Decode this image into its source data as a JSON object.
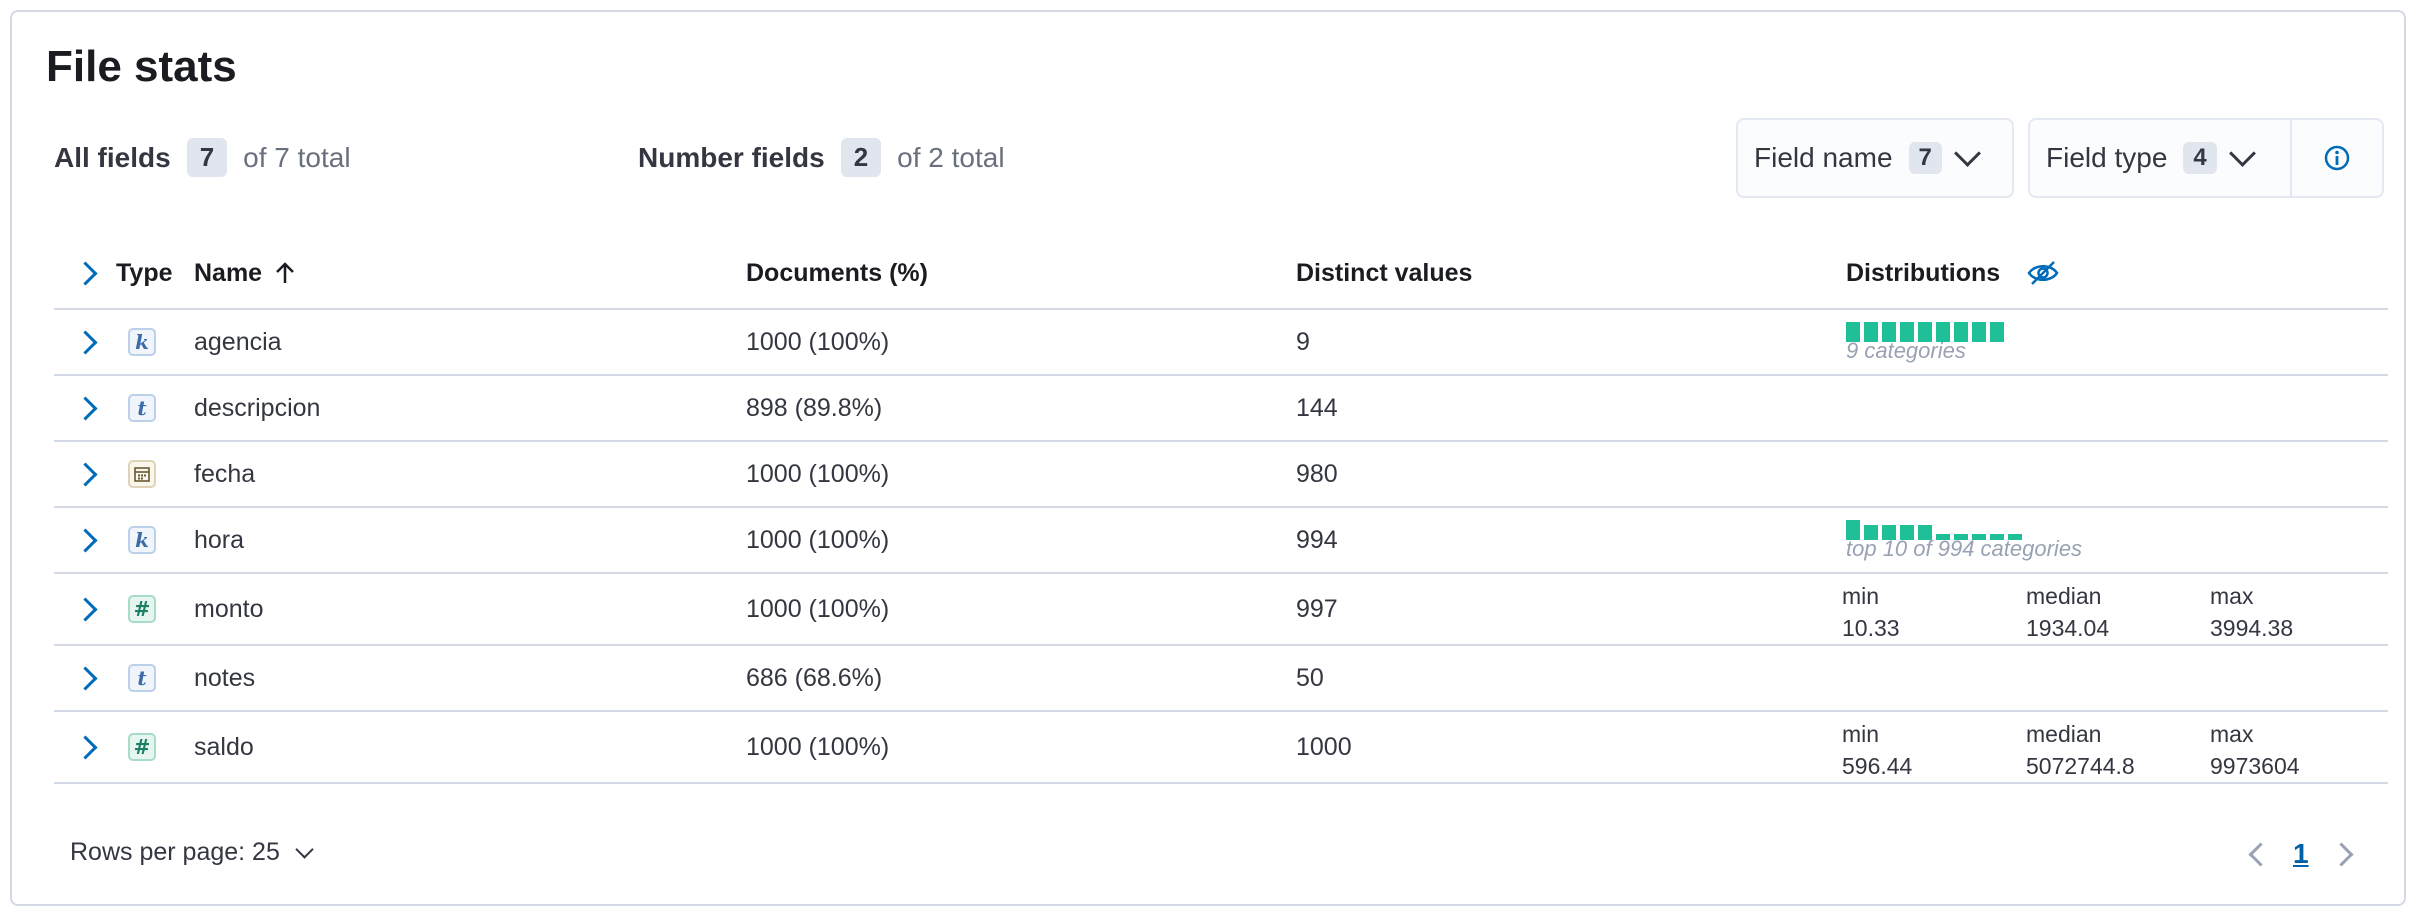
{
  "title": "File stats",
  "stats": {
    "all_fields": {
      "label": "All fields",
      "count": "7",
      "total": "of 7 total"
    },
    "number_fields": {
      "label": "Number fields",
      "count": "2",
      "total": "of 2 total"
    }
  },
  "filters": {
    "field_name": {
      "label": "Field name",
      "count": "7"
    },
    "field_type": {
      "label": "Field type",
      "count": "4"
    }
  },
  "icons": {
    "expand": "chevron-right-icon",
    "sort": "arrow-up-icon",
    "hide_distributions": "eye-closed-icon",
    "info": "info-icon",
    "dropdown": "chevron-down-icon"
  },
  "table": {
    "headers": {
      "type": "Type",
      "name": "Name",
      "documents": "Documents (%)",
      "distinct": "Distinct values",
      "distributions": "Distributions"
    },
    "rows": [
      {
        "type": "keyword",
        "type_glyph": "k",
        "name": "agencia",
        "documents": "1000 (100%)",
        "distinct": "9",
        "distribution": {
          "kind": "categories",
          "label": "9 categories",
          "bars": [
            1,
            1,
            1,
            1,
            1,
            1,
            1,
            1,
            1
          ]
        }
      },
      {
        "type": "text",
        "type_glyph": "t",
        "name": "descripcion",
        "documents": "898 (89.8%)",
        "distinct": "144",
        "distribution": null
      },
      {
        "type": "date",
        "type_glyph": "",
        "name": "fecha",
        "documents": "1000 (100%)",
        "distinct": "980",
        "distribution": null
      },
      {
        "type": "keyword",
        "type_glyph": "k",
        "name": "hora",
        "documents": "1000 (100%)",
        "distinct": "994",
        "distribution": {
          "kind": "categories",
          "label": "top 10 of 994 categories",
          "bars": [
            1,
            0.75,
            0.75,
            0.75,
            0.75,
            0.3,
            0.3,
            0.3,
            0.3,
            0.3
          ]
        }
      },
      {
        "type": "number",
        "type_glyph": "#",
        "name": "monto",
        "documents": "1000 (100%)",
        "distinct": "997",
        "distribution": {
          "kind": "numeric",
          "min_label": "min",
          "min": "10.33",
          "median_label": "median",
          "median": "1934.04",
          "max_label": "max",
          "max": "3994.38"
        }
      },
      {
        "type": "text",
        "type_glyph": "t",
        "name": "notes",
        "documents": "686 (68.6%)",
        "distinct": "50",
        "distribution": null
      },
      {
        "type": "number",
        "type_glyph": "#",
        "name": "saldo",
        "documents": "1000 (100%)",
        "distinct": "1000",
        "distribution": {
          "kind": "numeric",
          "min_label": "min",
          "min": "596.44",
          "median_label": "median",
          "median": "5072744.8",
          "max_label": "max",
          "max": "9973604"
        }
      }
    ]
  },
  "footer": {
    "rows_per_page": "Rows per page: 25",
    "current_page": "1"
  },
  "colors": {
    "accent": "#006bb8",
    "bar": "#1fbf98",
    "border": "#d3dae6"
  }
}
